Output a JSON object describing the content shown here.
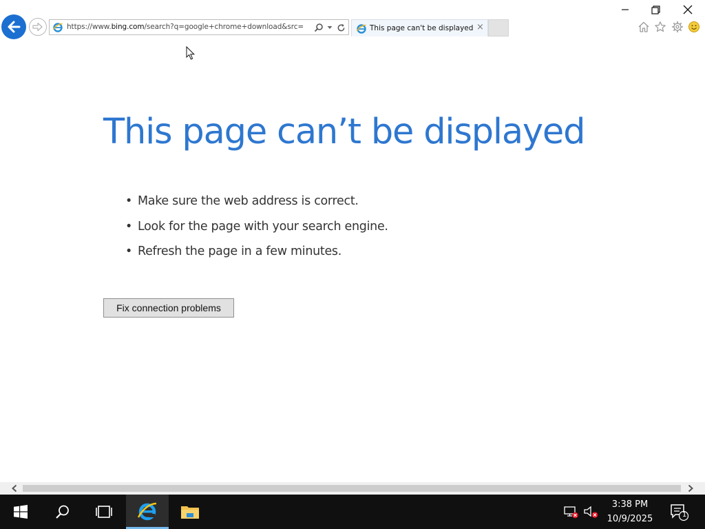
{
  "browser": {
    "address": {
      "prefix": "https://www.",
      "host": "bing.com",
      "rest": "/search?q=google+chrome+download&src="
    },
    "tab": {
      "title": "This page can't be displayed",
      "close_glyph": "×"
    }
  },
  "page": {
    "heading": "This page can’t be displayed",
    "tips": [
      "Make sure the web address is correct.",
      "Look for the page with your search engine.",
      "Refresh the page in a few minutes."
    ],
    "fix_button_label": "Fix connection problems"
  },
  "taskbar": {
    "time": "3:38 PM",
    "date": "10/9/2025",
    "notification_count": "1"
  },
  "icons": {
    "back": "back-arrow-icon",
    "forward": "forward-arrow-icon",
    "search": "search-icon",
    "dropdown": "chevron-down-icon",
    "refresh": "refresh-icon",
    "home": "home-icon",
    "favorites": "star-icon",
    "tools": "gear-icon",
    "feedback": "smiley-icon"
  },
  "colors": {
    "heading": "#2e77d0",
    "back_button": "#1b6fd1",
    "taskbar": "#101010",
    "taskbar_active_underline": "#76b9ed"
  }
}
